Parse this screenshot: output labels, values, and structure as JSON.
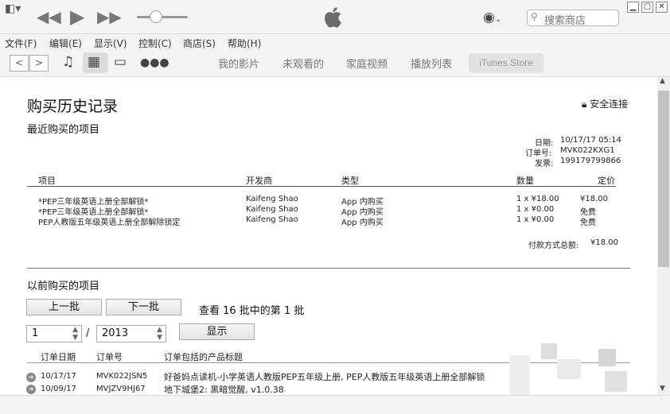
{
  "window": {
    "search_placeholder": "搜索商店",
    "minimize": "▁",
    "maximize": "▢",
    "close": "✕"
  },
  "menu": [
    "文件(F)",
    "编辑(E)",
    "显示(V)",
    "控制(C)",
    "商店(S)",
    "帮助(H)"
  ],
  "nav_tabs": [
    "我的影片",
    "未观看的",
    "家庭视频",
    "播放列表"
  ],
  "store_tab": "iTunes Store",
  "page": {
    "title": "购买历史记录",
    "secure_label": "安全连接",
    "recent_heading": "最近购买的项目",
    "date_label": "日期:",
    "date_value": "10/17/17 05:14",
    "order_label": "订单号:",
    "order_value": "MVK022KXG1",
    "invoice_label": "发票:",
    "invoice_value": "199179799866",
    "columns": {
      "item": "项目",
      "developer": "开发商",
      "type": "类型",
      "qty": "数量",
      "price": "定价"
    },
    "items": [
      {
        "name": "*PEP三年级英语上册全部解锁*",
        "developer": "Kaifeng Shao",
        "type": "App 内购买",
        "qty": "1 x ¥18.00",
        "price": "¥18.00"
      },
      {
        "name": "*PEP三年级英语上册全部解锁*",
        "developer": "Kaifeng Shao",
        "type": "App 内购买",
        "qty": "1 x ¥0.00",
        "price": "免费"
      },
      {
        "name": "PEP人教版五年级英语上册全部解除锁定",
        "developer": "Kaifeng Shao",
        "type": "App 内购买",
        "qty": "1 x ¥0.00",
        "price": "免费"
      }
    ],
    "total_label": "付款方式总额:",
    "total_value": "¥18.00",
    "previous_heading": "以前购买的项目",
    "prev_button": "上一批",
    "next_button": "下一批",
    "batch_text": "查看 16 批中的第 1 批",
    "month_value": "1",
    "separator": "/",
    "year_value": "2013",
    "show_button": "显示",
    "history_columns": {
      "date": "订单日期",
      "order": "订单号",
      "products": "订单包括的产品标题"
    },
    "history": [
      {
        "date": "10/17/17",
        "order": "MVK022JSN5",
        "products": "好爸妈点读机-小学英语人教版PEP五年级上册, PEP人教版五年级英语上册全部解锁"
      },
      {
        "date": "10/09/17",
        "order": "MVJZV9HJ67",
        "products": "地下城堡2: 黑暗觉醒, v1.0.38"
      }
    ]
  }
}
